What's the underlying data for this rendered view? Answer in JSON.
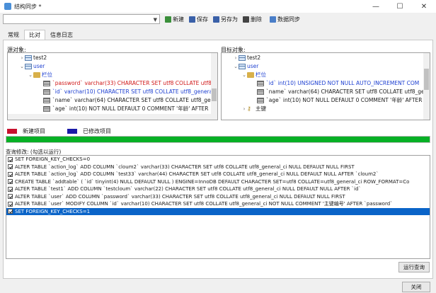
{
  "window": {
    "title": "结构同步 *"
  },
  "toolbar": {
    "combo_value": "",
    "buttons": [
      {
        "label": "新建",
        "color": "#3a8f3a"
      },
      {
        "label": "保存",
        "color": "#3a60a8"
      },
      {
        "label": "另存为",
        "color": "#3a60a8"
      },
      {
        "label": "删除",
        "color": "#444444"
      },
      {
        "label": "数据同步",
        "color": "#4a7ec8"
      }
    ]
  },
  "tabs": [
    "常规",
    "比对",
    "信息日志"
  ],
  "source": {
    "label": "源对象:",
    "rows": [
      "test2",
      "user",
      "栏位",
      "`password` varchar(33) CHARACTER SET utf8 COLLATE utf8_",
      "`id` varchar(10) CHARACTER SET utf8 COLLATE utf8_general",
      "`name` varchar(64) CHARACTER SET utf8 COLLATE utf8_gene",
      "`age` int(10) NOT NULL DEFAULT 0 COMMENT '年龄' AFTER"
    ]
  },
  "target": {
    "label": "目标对象:",
    "rows": [
      "test2",
      "user",
      "栏位",
      "`id` int(10) UNSIGNED NOT NULL AUTO_INCREMENT COM",
      "`name` varchar(64) CHARACTER SET utf8 COLLATE utf8_gene",
      "`age` int(10) NOT NULL DEFAULT 0 COMMENT '年龄' AFTER",
      "主键"
    ]
  },
  "legend": {
    "new": "新建项目",
    "modified": "已修改项目",
    "new_color": "#c8102e",
    "modified_color": "#1a1aa8"
  },
  "progress": {
    "percent": 100,
    "color": "#06b025"
  },
  "query": {
    "label": "查询修改: (勾选以运行)",
    "rows": [
      "SET FOREIGN_KEY_CHECKS=0",
      "ALTER TABLE `action_log` ADD COLUMN `cloum2` varchar(33) CHARACTER SET utf8 COLLATE utf8_general_ci NULL DEFAULT NULL FIRST",
      "ALTER TABLE `action_log` ADD COLUMN `test33` varchar(44) CHARACTER SET utf8 COLLATE utf8_general_ci NULL DEFAULT NULL AFTER `cloum2`",
      "CREATE TABLE `addtable` ( `id` tinyint(4) NULL DEFAULT NULL ) ENGINE=InnoDB DEFAULT CHARACTER SET=utf8 COLLATE=utf8_general_ci ROW_FORMAT=Co",
      "ALTER TABLE `test1` ADD COLUMN `testcloum` varchar(22) CHARACTER SET utf8 COLLATE utf8_general_ci NULL DEFAULT NULL AFTER `id`",
      "ALTER TABLE `user` ADD COLUMN `password` varchar(33) CHARACTER SET utf8 COLLATE utf8_general_ci NULL DEFAULT NULL FIRST",
      "ALTER TABLE `user` MODIFY COLUMN `id` varchar(10) CHARACTER SET utf8 COLLATE utf8_general_ci NOT NULL COMMENT '主键编号' AFTER `password`",
      "SET FOREIGN_KEY_CHECKS=1"
    ],
    "run_button": "运行查询"
  },
  "close_button": "关闭"
}
